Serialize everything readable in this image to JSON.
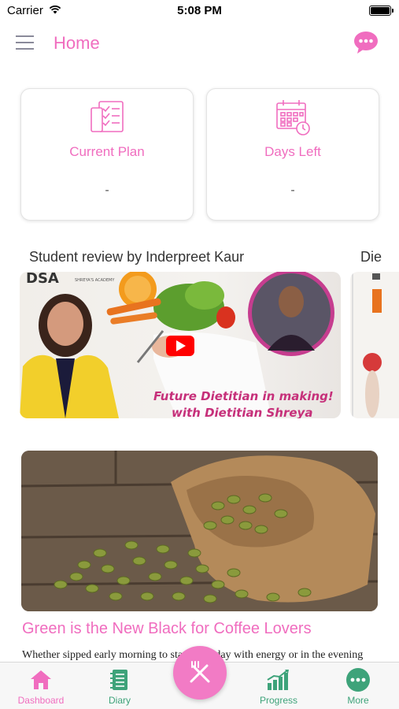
{
  "status_bar": {
    "carrier": "Carrier",
    "time": "5:08 PM"
  },
  "header": {
    "title": "Home",
    "menu_icon": "hamburger-menu-icon",
    "chat_icon": "chat-bubble-icon"
  },
  "cards": [
    {
      "title": "Current Plan",
      "value": "-",
      "icon": "checklist-icon"
    },
    {
      "title": "Days Left",
      "value": "-",
      "icon": "calendar-clock-icon"
    }
  ],
  "videos": [
    {
      "title": "Student review by Inderpreet Kaur",
      "caption_line1": "Future Dietitian in making!",
      "caption_line2": "with Dietitian Shreya",
      "logo_text": "DSA",
      "logo_sub": "SHREYA'S ACADEMY"
    },
    {
      "title": "Die"
    }
  ],
  "article": {
    "title": "Green is the New Black for Coffee Lovers",
    "excerpt": "Whether sipped early morning to start your day with energy or in the evening"
  },
  "tabs": [
    {
      "label": "Dashboard",
      "icon": "home-icon",
      "active": true
    },
    {
      "label": "Diary",
      "icon": "notebook-icon",
      "active": false
    },
    {
      "label": "Progress",
      "icon": "bar-chart-icon",
      "active": false
    },
    {
      "label": "More",
      "icon": "more-dots-icon",
      "active": false
    }
  ],
  "fab": {
    "icon": "fork-knife-icon"
  },
  "colors": {
    "accent": "#f06dbf",
    "tab_inactive": "#3ea37a"
  }
}
